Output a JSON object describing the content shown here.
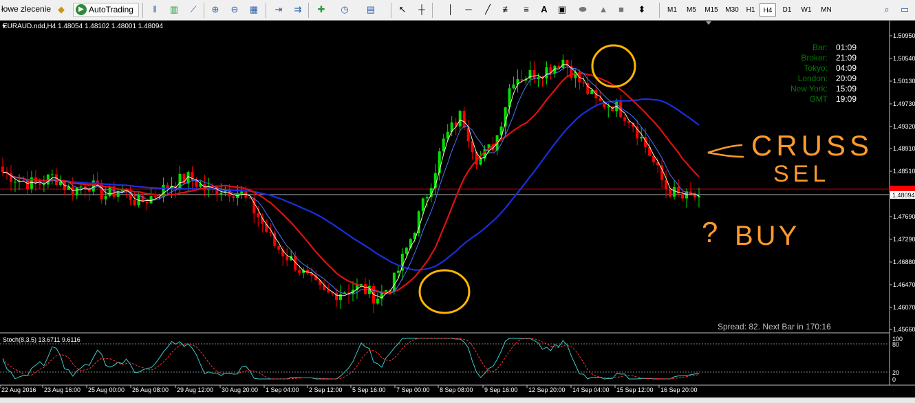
{
  "toolbar": {
    "new_order_label": "łowe zlecenie",
    "autotrading_label": "AutoTrading",
    "timeframes": [
      "M1",
      "M5",
      "M15",
      "M30",
      "H1",
      "H4",
      "D1",
      "W1",
      "MN"
    ],
    "active_timeframe": "H4"
  },
  "chart": {
    "header": "EURAUD.ndd,H4  1.48054 1.48102 1.48001 1.48094",
    "price_labels": [
      "1.50950",
      "1.50540",
      "1.50130",
      "1.49730",
      "1.49320",
      "1.48910",
      "1.48510",
      "1.48094",
      "1.47690",
      "1.47290",
      "1.46880",
      "1.46470",
      "1.46070",
      "1.45660"
    ],
    "current_price": "1.48094",
    "date_labels": [
      "22 Aug 2016",
      "23 Aug 16:00",
      "25 Aug 00:00",
      "26 Aug 08:00",
      "29 Aug 12:00",
      "30 Aug 20:00",
      "1 Sep 04:00",
      "2 Sep 12:00",
      "5 Sep 16:00",
      "7 Sep 00:00",
      "8 Sep 08:00",
      "9 Sep 16:00",
      "12 Sep 20:00",
      "14 Sep 04:00",
      "15 Sep 12:00",
      "16 Sep 20:00"
    ],
    "spread_text": "Spread: 82. Next Bar in 170:16",
    "clock": [
      {
        "label": "Bar:",
        "value": "01:09"
      },
      {
        "label": "Broker:",
        "value": "21:09"
      },
      {
        "label": "Tokyo:",
        "value": "04:09"
      },
      {
        "label": "London:",
        "value": "20:09"
      },
      {
        "label": "New York:",
        "value": "15:09"
      },
      {
        "label": "GMT",
        "value": "19:09"
      }
    ],
    "annotations": {
      "cross": "CRUSS",
      "sell": "SEL",
      "buy_q": "?",
      "buy": "BUY"
    }
  },
  "stoch": {
    "title": "Stoch(8,3,5) 13.6711 9.6116",
    "levels": [
      "100",
      "80",
      "20",
      "0"
    ]
  },
  "chart_data": {
    "type": "candlestick",
    "symbol": "EURAUD.ndd",
    "timeframe": "H4",
    "ohlc_last": {
      "open": 1.48054,
      "high": 1.48102,
      "low": 1.48001,
      "close": 1.48094
    },
    "y_range": [
      1.4566,
      1.5095
    ],
    "x_labels": [
      "22 Aug 2016",
      "23 Aug 16:00",
      "25 Aug 00:00",
      "26 Aug 08:00",
      "29 Aug 12:00",
      "30 Aug 20:00",
      "1 Sep 04:00",
      "2 Sep 12:00",
      "5 Sep 16:00",
      "7 Sep 00:00",
      "8 Sep 08:00",
      "9 Sep 16:00",
      "12 Sep 20:00",
      "14 Sep 04:00",
      "15 Sep 12:00",
      "16 Sep 20:00"
    ],
    "close_path": [
      1.4852,
      1.4838,
      1.4829,
      1.4845,
      1.4818,
      1.4832,
      1.481,
      1.4822,
      1.4796,
      1.4812,
      1.4833,
      1.4842,
      1.482,
      1.4823,
      1.4815,
      1.4775,
      1.4722,
      1.4695,
      1.466,
      1.4632,
      1.464,
      1.4648,
      1.4628,
      1.4655,
      1.4732,
      1.4815,
      1.491,
      1.4955,
      1.487,
      1.4905,
      1.502,
      1.5025,
      1.5035,
      1.5053,
      1.5012,
      1.4975,
      1.4972,
      1.4945,
      1.489,
      1.4825,
      1.4805,
      1.4809
    ],
    "series": [
      {
        "name": "fast MA",
        "color": "#f5f5c0"
      },
      {
        "name": "MA",
        "color": "#4a78ff"
      },
      {
        "name": "MA",
        "color": "#e01010"
      },
      {
        "name": "MA",
        "color": "#1a2ee0"
      }
    ],
    "stoch_levels": [
      100,
      80,
      20,
      0
    ]
  },
  "colors": {
    "bull": "#00e000",
    "bear": "#ff0000",
    "annotation": "#ff9a2e",
    "circle": "#ffb600",
    "clock_label": "#007a00",
    "clock_value": "#ffffff"
  }
}
